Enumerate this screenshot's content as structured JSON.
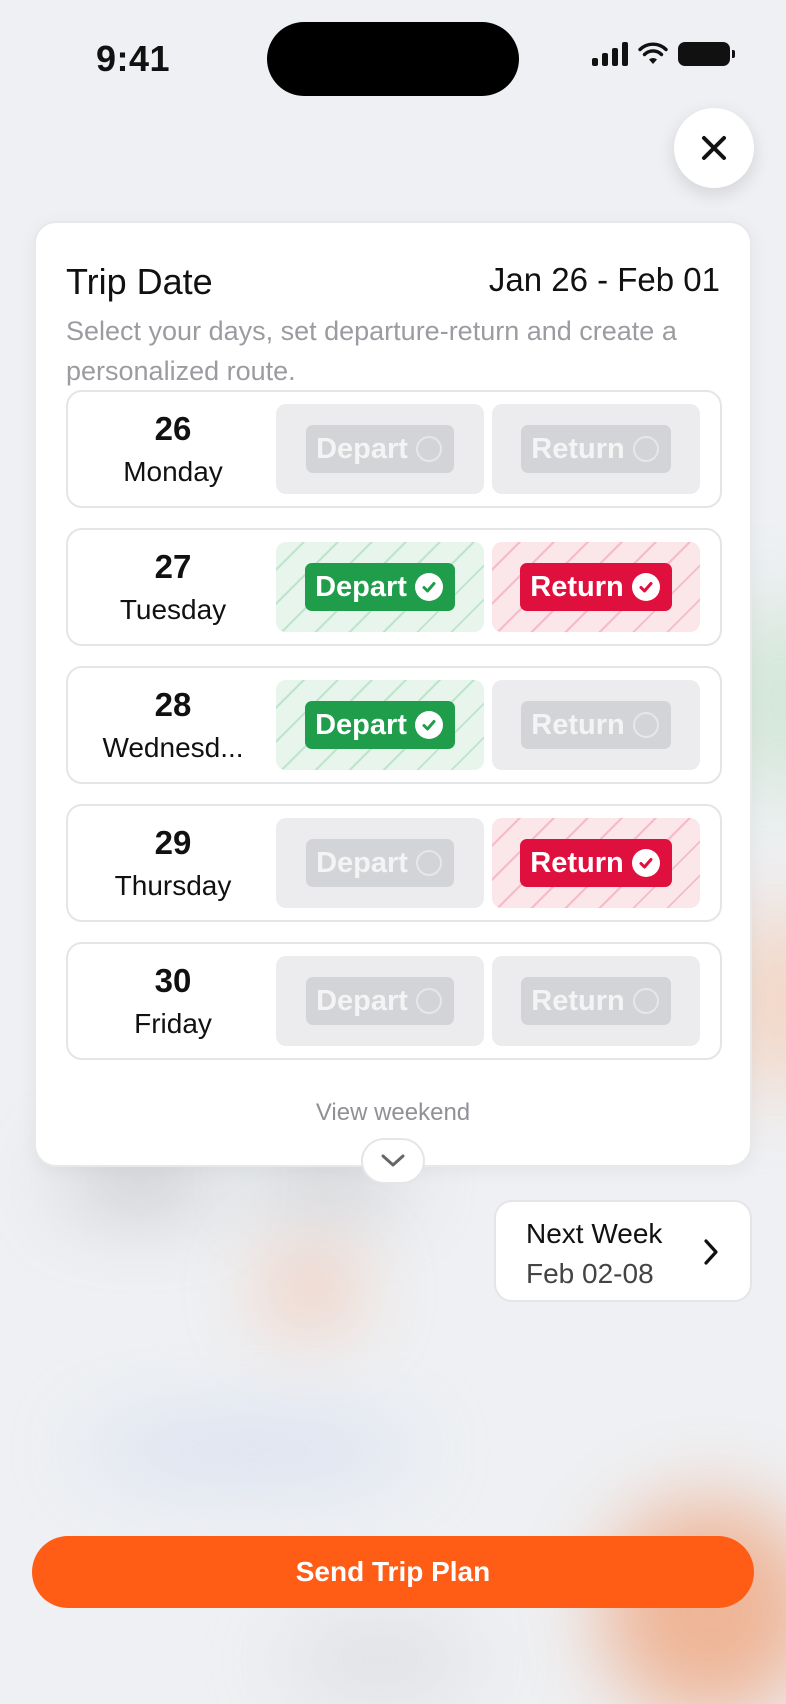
{
  "status_bar": {
    "time": "9:41"
  },
  "card": {
    "title": "Trip Date",
    "range": "Jan 26 - Feb 01",
    "description": "Select your days, set departure-return and create a personalized route.",
    "days": [
      {
        "num": "26",
        "name": "Monday",
        "depart_label": "Depart",
        "return_label": "Return",
        "depart_selected": false,
        "return_selected": false
      },
      {
        "num": "27",
        "name": "Tuesday",
        "depart_label": "Depart",
        "return_label": "Return",
        "depart_selected": true,
        "return_selected": true
      },
      {
        "num": "28",
        "name": "Wednesd...",
        "depart_label": "Depart",
        "return_label": "Return",
        "depart_selected": true,
        "return_selected": false
      },
      {
        "num": "29",
        "name": "Thursday",
        "depart_label": "Depart",
        "return_label": "Return",
        "depart_selected": false,
        "return_selected": true
      },
      {
        "num": "30",
        "name": "Friday",
        "depart_label": "Depart",
        "return_label": "Return",
        "depart_selected": false,
        "return_selected": false
      }
    ],
    "view_weekend": "View weekend"
  },
  "next_week": {
    "title": "Next Week",
    "range": "Feb 02-08"
  },
  "send_button": {
    "label": "Send Trip Plan"
  },
  "colors": {
    "accent": "#ff5c16",
    "depart_active": "#1f9d4a",
    "return_active": "#e0103e",
    "inactive": "#d3d4d7"
  },
  "icons": {
    "close": "close-icon",
    "check": "check-circle-icon",
    "radio": "radio-empty-icon",
    "expand": "chevron-down-icon",
    "next": "chevron-right-icon"
  }
}
